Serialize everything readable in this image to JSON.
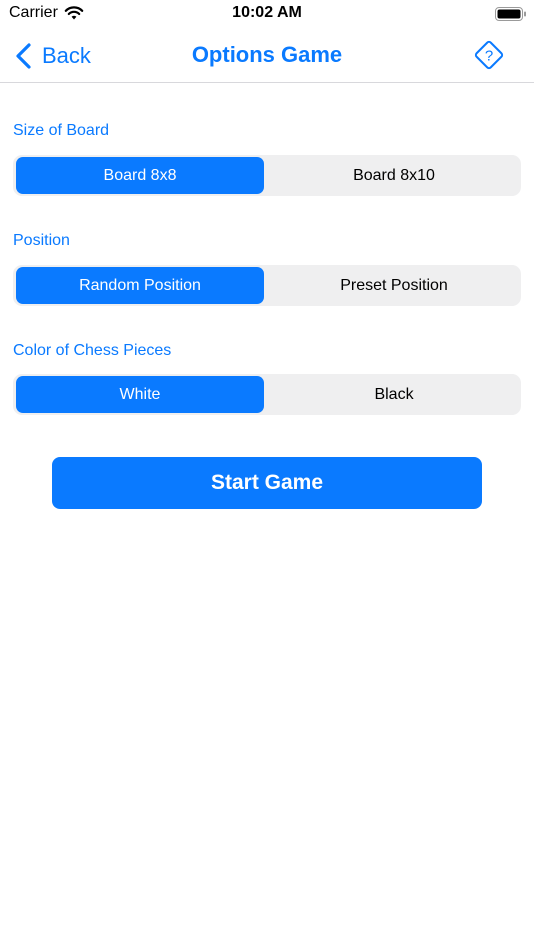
{
  "status_bar": {
    "carrier": "Carrier",
    "time": "10:02 AM",
    "icons": [
      "wifi-icon",
      "battery-icon"
    ]
  },
  "nav": {
    "back_label": "Back",
    "title": "Options Game",
    "help_icon": "help-diamond-icon"
  },
  "sections": {
    "board_size": {
      "label": "Size of Board",
      "options": [
        "Board 8x8",
        "Board 8x10"
      ],
      "selected": "Board 8x8"
    },
    "position": {
      "label": "Position",
      "options": [
        "Random Position",
        "Preset Position"
      ],
      "selected": "Random Position"
    },
    "color": {
      "label": "Color of Chess Pieces",
      "options": [
        "White",
        "Black"
      ],
      "selected": "White"
    }
  },
  "start_button_label": "Start Game",
  "colors": {
    "accent": "#0a7aff",
    "segment_bg": "#efeff0",
    "divider": "#d8d8dc"
  }
}
